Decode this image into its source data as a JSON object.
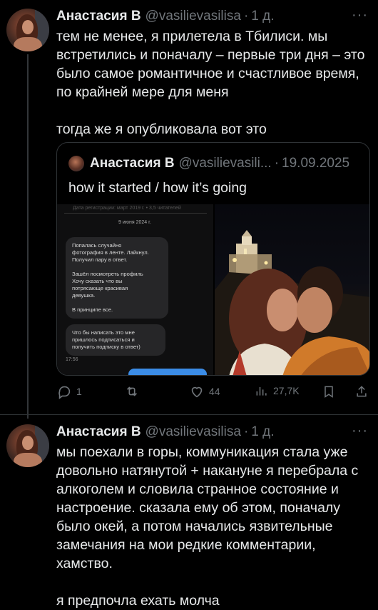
{
  "tweets": [
    {
      "name": "Анастасия В",
      "handle": "@vasilievasilisa",
      "time": "1 д.",
      "text": "тем не менее, я прилетела в Тбилиси. мы встретились и поначалу – первые три дня – это было самое романтичное и счастливое время, по крайней мере для меня\n\nтогда же я опубликовала вот это",
      "quote": {
        "name": "Анастасия В",
        "handle": "@vasilievasili...",
        "date": "19.09.2025",
        "text": "how it started / how it’s going",
        "screenshot": {
          "header_faint": "Дата регистрации: март 2019 г. • 3,5 читателей",
          "date": "9 июня 2024 г.",
          "bubble1": "Попалась случайно\nфотография в ленте. Лайкнул.\nПолучил пару в ответ.\n\nЗашёл посмотреть профиль\nХочу сказать что вы\nпотрясающе красивая\nдевушка.\n\nВ принципе все.",
          "bubble2": "Что бы написать это мне\nпришлось подписаться и\nполучить подписку в ответ)",
          "timestamp": "17:56"
        }
      },
      "actions": {
        "replies": "1",
        "retweets": "",
        "likes": "44",
        "views": "27,7K"
      }
    },
    {
      "name": "Анастасия В",
      "handle": "@vasilievasilisa",
      "time": "1 д.",
      "text": "мы поехали в горы, коммуникация стала уже довольно натянутой + накануне я перебрала с алкоголем и словила странное состояние и настроение. сказала ему об этом, поначалу было окей, а потом начались язвительные замечания на мои редкие комментарии, хамство.\n\nя предпочла ехать молча"
    }
  ],
  "colors": {
    "background": "#000000",
    "text": "#e7e9ea",
    "muted": "#71767b",
    "border": "#2f3336"
  }
}
